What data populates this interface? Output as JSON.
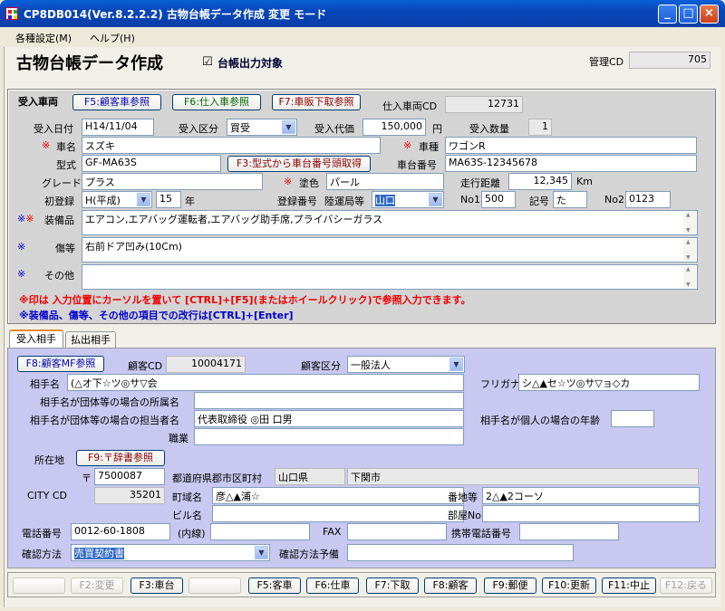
{
  "window": {
    "title": "CP8DB014(Ver.8.2.2.2) 古物台帳データ作成  変更 モード",
    "min": "_",
    "max": "□",
    "close": "×"
  },
  "menu": [
    "各種設定(M)",
    "ヘルプ(H)"
  ],
  "header": {
    "title": "古物台帳データ作成",
    "check_mark": "☑",
    "check_label": "台帳出力対象",
    "kanri_label": "管理CD",
    "kanri_value": "705"
  },
  "vehicle": {
    "section_label": "受入車両",
    "btn_f5": "F5:顧客車参照",
    "btn_f6": "F6:仕入車参照",
    "btn_f7": "F7:車販下取参照",
    "shiire_label": "仕入車両CD",
    "shiire_value": "12731",
    "ukeire_date_label": "受入日付",
    "ukeire_date": "H14/11/04",
    "kubun_label": "受入区分",
    "kubun": "買受",
    "price_label": "受入代価",
    "price": "150,000",
    "yen": "円",
    "qty_label": "受入数量",
    "qty": "1",
    "mark": "※",
    "mark2": "※ ※",
    "name_label": "車名",
    "name": "スズキ",
    "type_label": "車種",
    "type": "ワゴンR",
    "model_label": "型式",
    "model": "GF-MA63S",
    "btn_f3": "F3:型式から車台番号頭取得",
    "chassis_label": "車台番号",
    "chassis": "MA63S-12345678",
    "grade_label": "グレード",
    "grade": "プラス",
    "color_label": "塗色",
    "color": "パール",
    "mileage_label": "走行距離",
    "mileage": "12,345",
    "km": "Km",
    "first_label": "初登録",
    "era": "H(平成)",
    "year": "15",
    "year_unit": "年",
    "reg_label": "登録番号",
    "reg_office": "陸運局等",
    "reg_office_sel": "山口",
    "no1_label": "No1",
    "no1": "500",
    "kigo_label": "記号",
    "kigo": "た",
    "no2_label": "No2",
    "no2": "0123",
    "equip_label": "装備品",
    "equip": "エアコン,エアバッグ運転者,エアバッグ助手席,プライバシーガラス",
    "damage_label": "傷等",
    "damage": "右前ドア凹み(10Cm)",
    "other_label": "その他",
    "other": "",
    "note1": "※印は 入力位置にカーソルを置いて   [CTRL]+[F5](またはホイールクリック)で参照入力できます。",
    "note2": "※装備品、傷等、その他の項目での改行は[CTRL]+[Enter]"
  },
  "tabs": [
    "受入相手",
    "払出相手"
  ],
  "partner": {
    "btn_f8": "F8:顧客MF参照",
    "cust_cd_label": "顧客CD",
    "cust_cd": "10004171",
    "cust_kubun_label": "顧客区分",
    "cust_kubun": "一般法人",
    "name_label": "相手名",
    "name": "(△オ下☆ツ◎サ▽会",
    "kana_label": "フリガナ",
    "kana": "シ△▲セ☆ツ◎サ▽ョ◇カ",
    "org_label": "相手名が団体等の場合の所属名",
    "org": "",
    "rep_label": "相手名が団体等の場合の担当者名",
    "rep": "代表取締役 ◎田 口男",
    "age_label": "相手名が個人の場合の年齢",
    "age": "",
    "job_label": "職業",
    "job": "",
    "addr_label": "所在地",
    "btn_f9": "F9:〒辞書参照",
    "zip_mark": "〒",
    "zip": "7500087",
    "pref_label": "都道府県郡市区町村",
    "pref": "山口県",
    "city": "下関市",
    "citycd_label": "CITY CD",
    "citycd": "35201",
    "town_label": "町域名",
    "town": "彦△▲浦☆",
    "banchi_label": "番地等",
    "banchi": "2△▲2コーソ",
    "bldg_label": "ビル名",
    "bldg": "",
    "room_label": "部屋No",
    "room": "",
    "tel_label": "電話番号",
    "tel": "0012-60-1808",
    "ext_label": "(内線)",
    "ext": "",
    "fax_label": "FAX",
    "fax": "",
    "mobile_label": "携帯電話番号",
    "mobile": "",
    "confirm_label": "確認方法",
    "confirm": "売買契約書",
    "confirm_sub_label": "確認方法予備",
    "confirm_sub": ""
  },
  "fkeys": [
    "",
    "F2:変更",
    "F3:車台",
    "",
    "F5:客車",
    "F6:仕車",
    "F7:下取",
    "F8:顧客",
    "F9:郵便",
    "F10:更新",
    "F11:中止",
    "F12:戻る"
  ]
}
